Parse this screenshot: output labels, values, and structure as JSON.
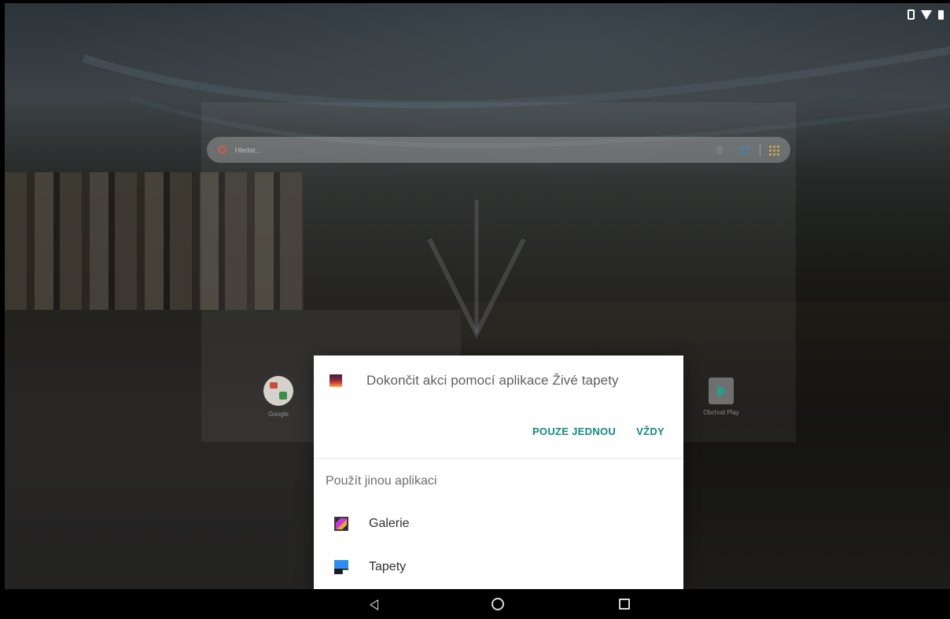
{
  "status_bar": {
    "icons": [
      "vibrate-icon",
      "wifi-icon",
      "battery-icon"
    ]
  },
  "launcher": {
    "search": {
      "logo": "G",
      "placeholder": "Hledat..."
    },
    "apps": [
      {
        "label": "Google",
        "icon": "google-folder-icon"
      },
      {
        "label": "Obchod Play",
        "icon": "play-store-icon"
      }
    ]
  },
  "dialog": {
    "title": "Dokončit akci pomocí aplikace Živé tapety",
    "once_label": "POUZE JEDNOU",
    "always_label": "VŽDY",
    "other_apps_label": "Použít jinou aplikaci",
    "options": [
      {
        "label": "Galerie",
        "icon": "gallery-icon"
      },
      {
        "label": "Tapety",
        "icon": "wallpapers-icon"
      }
    ],
    "accent_color": "#138a7e"
  },
  "nav_bar": {
    "buttons": [
      "back-icon",
      "home-icon",
      "recents-icon"
    ]
  }
}
